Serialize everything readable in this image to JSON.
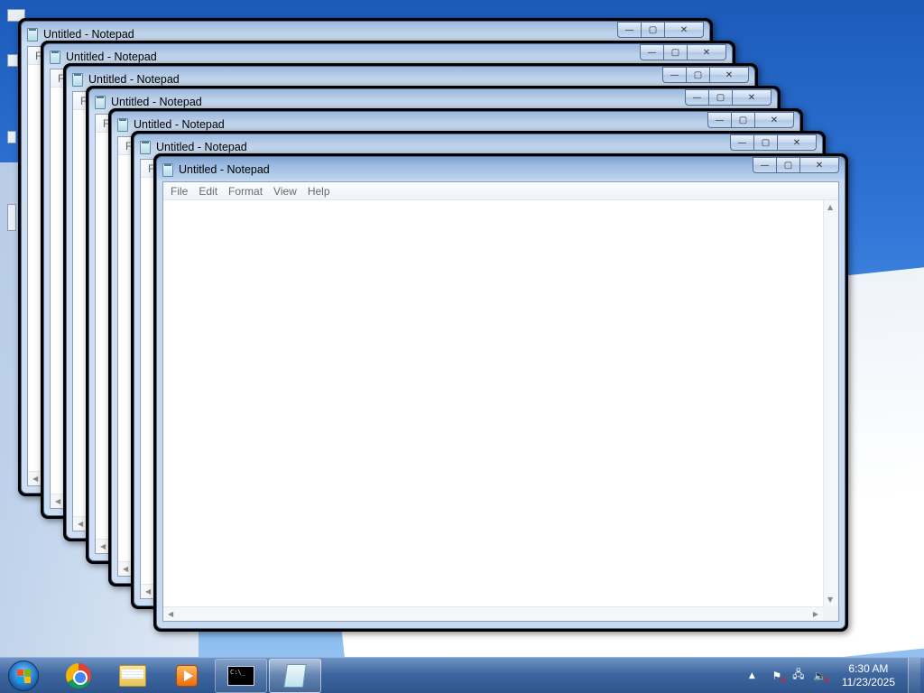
{
  "desktop": {
    "icons": [
      "desktop-icon",
      "desktop-icon",
      "desktop-icon",
      "desktop-icon"
    ]
  },
  "windows": [
    {
      "title": "Untitled - Notepad",
      "menu_stub": "Fi"
    },
    {
      "title": "Untitled - Notepad",
      "menu_stub": "Fi"
    },
    {
      "title": "Untitled - Notepad",
      "menu_stub": "Fi"
    },
    {
      "title": "Untitled - Notepad",
      "menu_stub": "Fi"
    },
    {
      "title": "Untitled - Notepad",
      "menu_stub": "Fi"
    },
    {
      "title": "Untitled - Notepad",
      "menu_stub": "Fi"
    },
    {
      "title": "Untitled - Notepad",
      "menu_stub": "Fi"
    }
  ],
  "active_window": {
    "title": "Untitled - Notepad",
    "menu": {
      "file": "File",
      "edit": "Edit",
      "format": "Format",
      "view": "View",
      "help": "Help"
    },
    "caption": {
      "minimize": "—",
      "maximize": "▢",
      "close": "✕"
    },
    "text_content": ""
  },
  "taskbar": {
    "apps": [
      {
        "name": "chrome-icon"
      },
      {
        "name": "folder-icon"
      },
      {
        "name": "media-player-icon"
      },
      {
        "name": "command-prompt-icon",
        "label": "C:\\_"
      },
      {
        "name": "notepad-icon"
      }
    ],
    "tray": {
      "show_hidden": "▲",
      "time": "6:30 AM",
      "date": "11/23/2025"
    }
  },
  "cursor": {
    "state": "busy"
  }
}
